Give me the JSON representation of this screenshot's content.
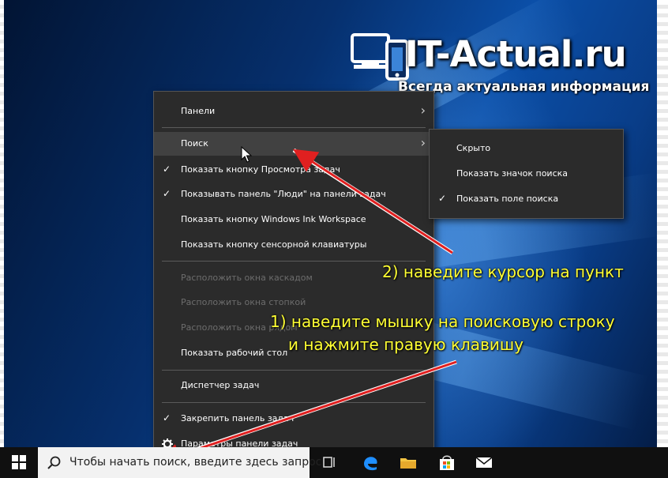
{
  "logo": {
    "title": "IT-Actual.ru",
    "subtitle": "Всегда актуальная информация"
  },
  "context_menu": {
    "items": [
      {
        "label": "Панели",
        "submenu": true
      },
      {
        "label": "Поиск",
        "submenu": true,
        "highlighted": true
      },
      {
        "label": "Показать кнопку Просмотра задач",
        "checked": true
      },
      {
        "label": "Показывать панель \"Люди\" на панели задач",
        "checked": true
      },
      {
        "label": "Показать кнопку Windows Ink Workspace"
      },
      {
        "label": "Показать кнопку сенсорной клавиатуры"
      },
      {
        "label": "Расположить окна каскадом",
        "disabled": true
      },
      {
        "label": "Расположить окна стопкой",
        "disabled": true
      },
      {
        "label": "Расположить окна рядом",
        "disabled": true
      },
      {
        "label": "Показать рабочий стол"
      },
      {
        "label": "Диспетчер задач"
      },
      {
        "label": "Закрепить панель задач",
        "checked": true
      },
      {
        "label": "Параметры панели задач",
        "icon": "gear-icon"
      }
    ]
  },
  "submenu": {
    "items": [
      {
        "label": "Скрыто"
      },
      {
        "label": "Показать значок поиска"
      },
      {
        "label": "Показать поле поиска",
        "checked": true
      }
    ]
  },
  "annotations": {
    "step2": "2) наведите курсор на пункт",
    "step1_line1": "1) наведите мышку на поисковую строку",
    "step1_line2": "и нажмите правую клавишу"
  },
  "taskbar": {
    "search_placeholder": "Чтобы начать поиск, введите здесь запрос",
    "icons": [
      "windows-logo-icon",
      "search-icon",
      "task-view-icon",
      "edge-icon",
      "file-explorer-icon",
      "store-icon",
      "mail-icon"
    ]
  },
  "colors": {
    "annotation": "#ffff33",
    "arrow": "#e02020",
    "menu_bg": "#2b2b2b",
    "highlight": "#414141"
  },
  "glyphs": {
    "check": "✓",
    "chevron": "›"
  }
}
